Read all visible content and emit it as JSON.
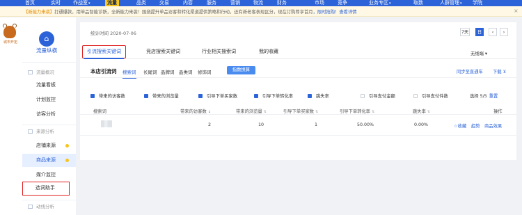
{
  "topnav": {
    "items": [
      {
        "label": "首页"
      },
      {
        "label": "实时"
      },
      {
        "label": "作战室",
        "caret": "▾"
      },
      {
        "label": "流量",
        "active": true
      },
      {
        "label": "品类"
      },
      {
        "label": "交易"
      },
      {
        "label": "内容"
      },
      {
        "label": "服务"
      },
      {
        "label": "营销"
      },
      {
        "label": "物流"
      },
      {
        "label": "财务"
      },
      {
        "label": "市场"
      },
      {
        "label": "竞争"
      },
      {
        "label": "业务专区",
        "caret": "▾"
      },
      {
        "label": "取数"
      },
      {
        "label": "人群管理",
        "caret": "▾"
      },
      {
        "label": "学院"
      }
    ]
  },
  "notice": {
    "tag": "【新能力来袭】",
    "text": "打通爆款，用单品智能诊断，全新能力来袭！围绕提升单品访客和转化渠道提供策略和行动，还有新老客表现区分，现在订购尊享首月",
    "link": "，限时抢购！",
    "detail": "查看详情",
    "close": "×"
  },
  "sidebar": {
    "logo_text": "城市开拓",
    "brand_glyph": "⌂",
    "brand_label": "流量纵横",
    "groups": [
      {
        "label": "流量概况",
        "items": [
          {
            "label": "流量看板"
          },
          {
            "label": "计划监控"
          },
          {
            "label": "访客分析"
          }
        ]
      },
      {
        "label": "来源分析",
        "items": [
          {
            "label": "店铺来源",
            "dot": true
          },
          {
            "label": "商品来源",
            "dot": true,
            "highlighted": true
          },
          {
            "label": "媒介监控"
          },
          {
            "label": "选词助手",
            "framed": true
          }
        ]
      },
      {
        "label": "动线分析",
        "items": []
      }
    ]
  },
  "main": {
    "stat_date": "统计时间 2020-07-06",
    "range": {
      "seven": "7天",
      "day": "日",
      "prev": "‹",
      "next": "›"
    },
    "tabs": [
      {
        "label": "引流搜索关键词",
        "active": true
      },
      {
        "label": "竞店搜索关键词"
      },
      {
        "label": "行业相关搜索词"
      },
      {
        "label": "我的收藏"
      }
    ],
    "unweighted": "无线端 ▾",
    "section_title": "本店引流词",
    "subtabs": [
      {
        "label": "搜索词",
        "active": true
      },
      {
        "label": "长尾词"
      },
      {
        "label": "品牌词"
      },
      {
        "label": "品类词"
      },
      {
        "label": "修饰词"
      }
    ],
    "pill": "指数换算",
    "sync": "同步至直通车",
    "download": "下载 ⊻",
    "metrics": [
      {
        "label": "带来的访客数",
        "checked": true
      },
      {
        "label": "带来的浏览量",
        "checked": true
      },
      {
        "label": "引导下单买家数",
        "checked": true
      },
      {
        "label": "引导下单转化率",
        "checked": true
      },
      {
        "label": "跳失率",
        "checked": true
      },
      {
        "label": "引导支付金额",
        "checked": false
      },
      {
        "label": "引导支付件数",
        "checked": false
      }
    ],
    "selected": "选择 5/5",
    "reset": "重置",
    "columns": [
      {
        "label": "搜索词"
      },
      {
        "label": "带来的访客数",
        "sort": "↓",
        "sort_on": true
      },
      {
        "label": "带来的浏览量",
        "sort": "⇅"
      },
      {
        "label": "引导下单买家数",
        "sort": "⇅"
      },
      {
        "label": "引导下单转化率",
        "sort": "⇅"
      },
      {
        "label": "跳失率",
        "sort": "⇅"
      },
      {
        "label": "操作"
      }
    ],
    "rows": [
      {
        "keyword": "",
        "visitors": "2",
        "views": "10",
        "buyers": "1",
        "conversion": "50.00%",
        "bounce": "0.00%",
        "actions": {
          "fav": "☆收藏",
          "trend": "趋势",
          "effect": "商品效果"
        }
      }
    ]
  }
}
